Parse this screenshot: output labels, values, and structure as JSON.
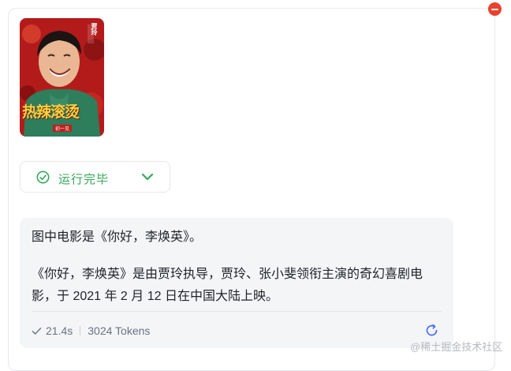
{
  "poster": {
    "title_art": "热辣滚烫",
    "top_name": "贾玲",
    "bottom_tag": "初一见",
    "colors": {
      "background": "#b31b1b",
      "jacket": "#2e7d5b",
      "title": "#f6d23c"
    }
  },
  "status": {
    "label": "运行完毕",
    "icon": "check-circle-icon",
    "color": "#37a85a"
  },
  "answer": {
    "line1": "图中电影是《你好，李焕英》。",
    "line2": "《你好，李焕英》是由贾玲执导，贾玲、张小斐领衔主演的奇幻喜剧电影，于 2021 年 2 月 12 日在中国大陆上映。",
    "duration": "21.4s",
    "tokens": "3024 Tokens"
  },
  "watermark": "@稀土掘金技术社区",
  "accent_remove": "#e8422e"
}
